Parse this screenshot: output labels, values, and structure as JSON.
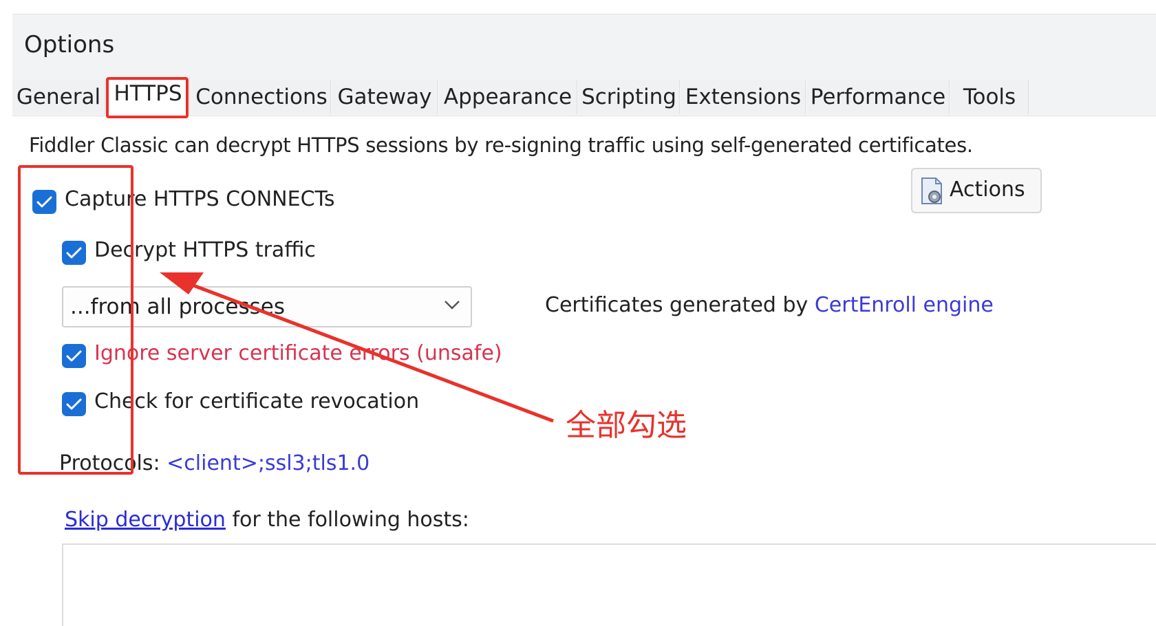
{
  "window": {
    "title": "Options"
  },
  "tabs": [
    {
      "label": "General"
    },
    {
      "label": "HTTPS"
    },
    {
      "label": "Connections"
    },
    {
      "label": "Gateway"
    },
    {
      "label": "Appearance"
    },
    {
      "label": "Scripting"
    },
    {
      "label": "Extensions"
    },
    {
      "label": "Performance"
    },
    {
      "label": "Tools"
    }
  ],
  "active_tab": "HTTPS",
  "https": {
    "description": "Fiddler Classic can decrypt HTTPS sessions by re-signing traffic using self-generated certificates.",
    "capture_connects": {
      "label": "Capture HTTPS CONNECTs",
      "checked": true
    },
    "decrypt_traffic": {
      "label": "Decrypt HTTPS traffic",
      "checked": true
    },
    "process_filter": {
      "selected": "...from all processes"
    },
    "cert_prefix": "Certificates generated by ",
    "cert_engine_link": "CertEnroll engine",
    "ignore_errors": {
      "label": "Ignore server certificate errors (unsafe)",
      "checked": true
    },
    "check_revocation": {
      "label": "Check for certificate revocation",
      "checked": true
    },
    "protocols_label": "Protocols: ",
    "protocols_value": "<client>;ssl3;tls1.0",
    "skip_link": "Skip decryption",
    "skip_suffix": " for the following hosts:",
    "actions_label": "Actions"
  },
  "annotation": {
    "text": "全部勾选",
    "color": "#e8322b"
  },
  "colors": {
    "checkbox": "#1a6fd6",
    "unsafe_text": "#d8334f",
    "link": "#2b2bd6",
    "annotation": "#e8322b"
  }
}
